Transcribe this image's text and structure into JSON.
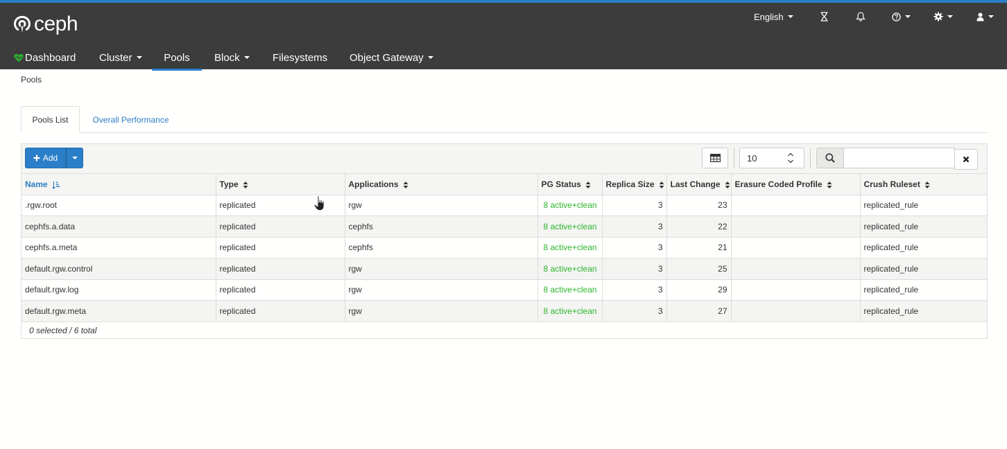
{
  "app": {
    "logo_text": "ceph"
  },
  "topbar": {
    "language": "English",
    "icons": [
      "hourglass-icon",
      "bell-icon",
      "help-icon",
      "gear-icon",
      "user-icon"
    ]
  },
  "nav": {
    "items": [
      {
        "label": "Dashboard",
        "icon": "heartbeat-icon",
        "dropdown": false,
        "active": false
      },
      {
        "label": "Cluster",
        "dropdown": true,
        "active": false
      },
      {
        "label": "Pools",
        "dropdown": false,
        "active": true
      },
      {
        "label": "Block",
        "dropdown": true,
        "active": false
      },
      {
        "label": "Filesystems",
        "dropdown": false,
        "active": false
      },
      {
        "label": "Object Gateway",
        "dropdown": true,
        "active": false
      }
    ]
  },
  "breadcrumb": "Pools",
  "tabs": [
    {
      "label": "Pools List",
      "active": true
    },
    {
      "label": "Overall Performance",
      "active": false
    }
  ],
  "toolbar": {
    "add_label": "Add",
    "rows_per_page": "10",
    "search_value": ""
  },
  "table": {
    "columns": [
      "Name",
      "Type",
      "Applications",
      "PG Status",
      "Replica Size",
      "Last Change",
      "Erasure Coded Profile",
      "Crush Ruleset"
    ],
    "sorted_column": "Name",
    "rows": [
      [
        ".rgw.root",
        "replicated",
        "rgw",
        "8 active+clean",
        "3",
        "23",
        "",
        "replicated_rule"
      ],
      [
        "cephfs.a.data",
        "replicated",
        "cephfs",
        "8 active+clean",
        "3",
        "22",
        "",
        "replicated_rule"
      ],
      [
        "cephfs.a.meta",
        "replicated",
        "cephfs",
        "8 active+clean",
        "3",
        "21",
        "",
        "replicated_rule"
      ],
      [
        "default.rgw.control",
        "replicated",
        "rgw",
        "8 active+clean",
        "3",
        "25",
        "",
        "replicated_rule"
      ],
      [
        "default.rgw.log",
        "replicated",
        "rgw",
        "8 active+clean",
        "3",
        "29",
        "",
        "replicated_rule"
      ],
      [
        "default.rgw.meta",
        "replicated",
        "rgw",
        "8 active+clean",
        "3",
        "27",
        "",
        "replicated_rule"
      ]
    ],
    "footer": "0 selected / 6 total"
  },
  "colors": {
    "topbar_bg": "#3c3c3c",
    "accent": "#2b7ec8",
    "status_ok": "#2cb52c",
    "heartbeat": "#2cb52c"
  }
}
